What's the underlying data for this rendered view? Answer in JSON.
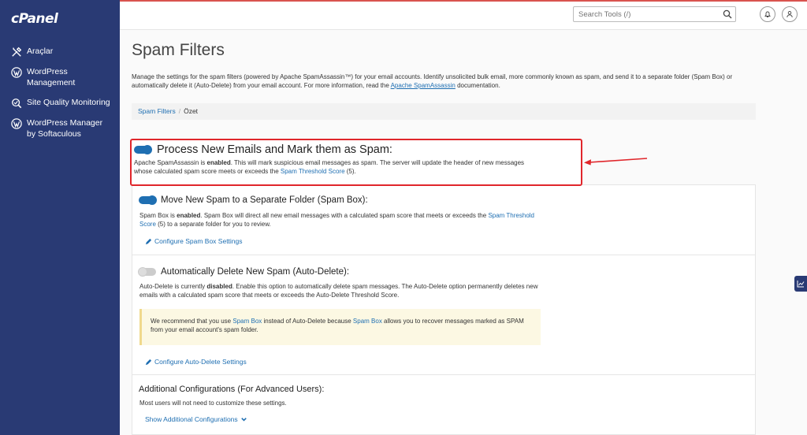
{
  "app": {
    "logo": "cPanel"
  },
  "sidebar": {
    "items": [
      {
        "label": "Araçlar",
        "icon": "tools-icon"
      },
      {
        "label": "WordPress Management",
        "icon": "wordpress-icon"
      },
      {
        "label": "Site Quality Monitoring",
        "icon": "site-quality-icon"
      },
      {
        "label": "WordPress Manager by Softaculous",
        "icon": "wordpress-icon"
      }
    ]
  },
  "header": {
    "search_placeholder": "Search Tools (/)",
    "icons": [
      "search-icon",
      "bell-icon",
      "user-icon"
    ]
  },
  "page": {
    "title": "Spam Filters",
    "intro_1": "Manage the settings for the spam filters (powered by Apache SpamAssassin™) for your email accounts. Identify unsolicited bulk email, more commonly known as spam, and send it to a separate folder (Spam Box) or automatically delete it (Auto-Delete) from your email account. For more information, read the ",
    "intro_link": "Apache SpamAssassin",
    "intro_2": " documentation."
  },
  "breadcrumb": {
    "parent": "Spam Filters",
    "separator": "/",
    "current": "Özet"
  },
  "process": {
    "enabled": true,
    "title": "Process New Emails and Mark them as Spam:",
    "desc_1": "Apache SpamAssassin is ",
    "desc_bold": "enabled",
    "desc_2": ". This will mark suspicious email messages as spam. The server will update the header of new messages whose calculated spam score meets or exceeds the ",
    "desc_link": "Spam Threshold Score",
    "desc_3": " (5)."
  },
  "spam_box": {
    "enabled": true,
    "title": "Move New Spam to a Separate Folder (Spam Box):",
    "desc_1": "Spam Box is ",
    "desc_bold": "enabled",
    "desc_2": ". Spam Box will direct all new email messages with a calculated spam score that meets or exceeds the ",
    "desc_link": "Spam Threshold Score",
    "desc_3": " (5) to a separate folder for you to review.",
    "config_link": "Configure Spam Box Settings"
  },
  "auto_delete": {
    "enabled": false,
    "title": "Automatically Delete New Spam (Auto-Delete):",
    "desc_1": "Auto-Delete is currently ",
    "desc_bold": "disabled",
    "desc_2": ". Enable this option to automatically delete spam messages. The Auto-Delete option permanently deletes new emails with a calculated spam score that meets or exceeds the Auto-Delete Threshold Score.",
    "notice_1": "We recommend that you use ",
    "notice_link_1": "Spam Box",
    "notice_2": " instead of Auto-Delete because ",
    "notice_link_2": "Spam Box",
    "notice_3": " allows you to recover messages marked as SPAM from your email account's spam folder.",
    "config_link": "Configure Auto-Delete Settings"
  },
  "advanced": {
    "title": "Additional Configurations (For Advanced Users):",
    "desc": "Most users will not need to customize these settings.",
    "show_link": "Show Additional Configurations"
  },
  "colors": {
    "sidebar": "#293a74",
    "accent": "#1f6fb2",
    "highlight": "#e0262b",
    "notice_bg": "#fcf8e3"
  }
}
